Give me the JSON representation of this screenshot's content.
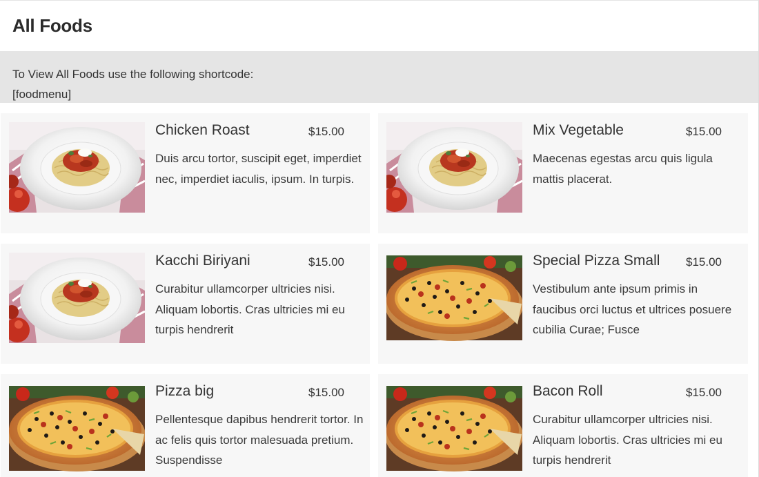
{
  "header": {
    "title": "All Foods"
  },
  "notice": {
    "line1": "To View All Foods use the following shortcode:",
    "line2": "[foodmenu]"
  },
  "foods": [
    {
      "name": "Chicken Roast",
      "price": "$15.00",
      "description": "Duis arcu tortor, suscipit eget, imperdiet nec, imperdiet iaculis, ipsum. In turpis.",
      "image": "pasta-plate"
    },
    {
      "name": "Mix Vegetable",
      "price": "$15.00",
      "description": "Maecenas egestas arcu quis ligula mattis placerat.",
      "image": "pasta-plate"
    },
    {
      "name": "Kacchi Biriyani",
      "price": "$15.00",
      "description": "Curabitur ullamcorper ultricies nisi. Aliquam lobortis. Cras ultricies mi eu turpis hendrerit",
      "image": "pasta-plate"
    },
    {
      "name": "Special Pizza Small",
      "price": "$15.00",
      "description": "Vestibulum ante ipsum primis in faucibus orci luctus et ultrices posuere cubilia Curae; Fusce",
      "image": "pizza"
    },
    {
      "name": "Pizza big",
      "price": "$15.00",
      "description": "Pellentesque dapibus hendrerit tortor. In ac felis quis tortor malesuada pretium. Suspendisse",
      "image": "pizza"
    },
    {
      "name": "Bacon Roll",
      "price": "$15.00",
      "description": "Curabitur ullamcorper ultricies nisi. Aliquam lobortis. Cras ultricies mi eu turpis hendrerit",
      "image": "pizza"
    }
  ]
}
